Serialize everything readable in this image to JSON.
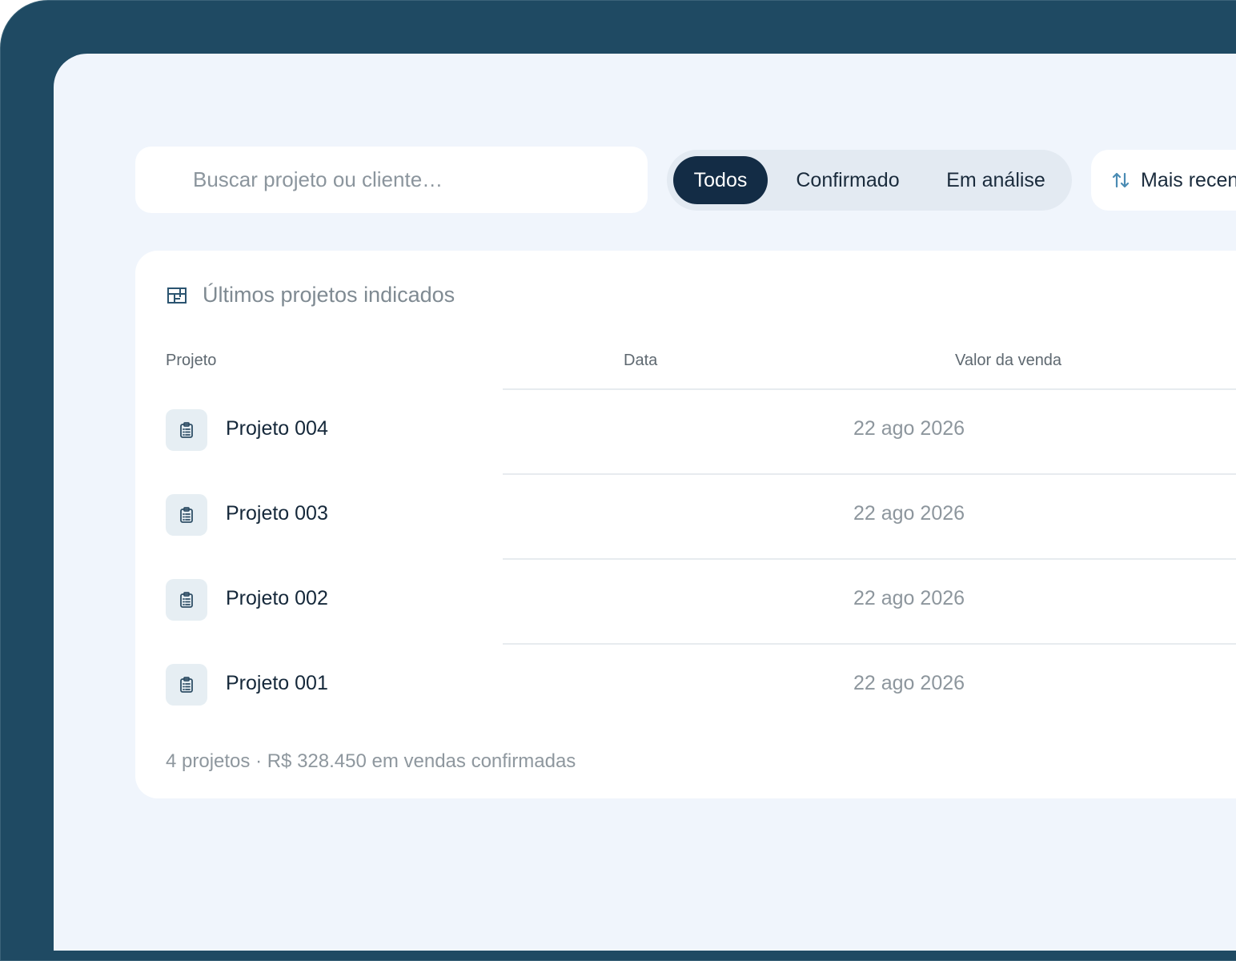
{
  "search": {
    "placeholder": "Buscar projeto ou cliente…"
  },
  "filters": [
    {
      "label": "Todos",
      "active": true
    },
    {
      "label": "Confirmado",
      "active": false
    },
    {
      "label": "Em análise",
      "active": false
    }
  ],
  "sort": {
    "label": "Mais recentes",
    "icon": "sort-arrows-icon"
  },
  "card": {
    "title": "Últimos projetos indicados",
    "title_icon": "grid-icon",
    "columns": {
      "project": "Projeto",
      "date": "Data",
      "value": "Valor da venda"
    },
    "rows": [
      {
        "name": "Projeto 004",
        "date": "22 ago 2026",
        "icon": "clipboard-icon"
      },
      {
        "name": "Projeto 003",
        "date": "22 ago 2026",
        "icon": "clipboard-icon"
      },
      {
        "name": "Projeto 002",
        "date": "22 ago 2026",
        "icon": "clipboard-icon"
      },
      {
        "name": "Projeto 001",
        "date": "22 ago 2026",
        "icon": "clipboard-icon"
      }
    ],
    "footer": "4 projetos · R$ 328.450 em vendas confirmadas"
  },
  "colors": {
    "frame": "#1f4a63",
    "background": "#f0f5fc",
    "active_chip": "#132c45",
    "accent_icon": "#4a8bb3"
  }
}
